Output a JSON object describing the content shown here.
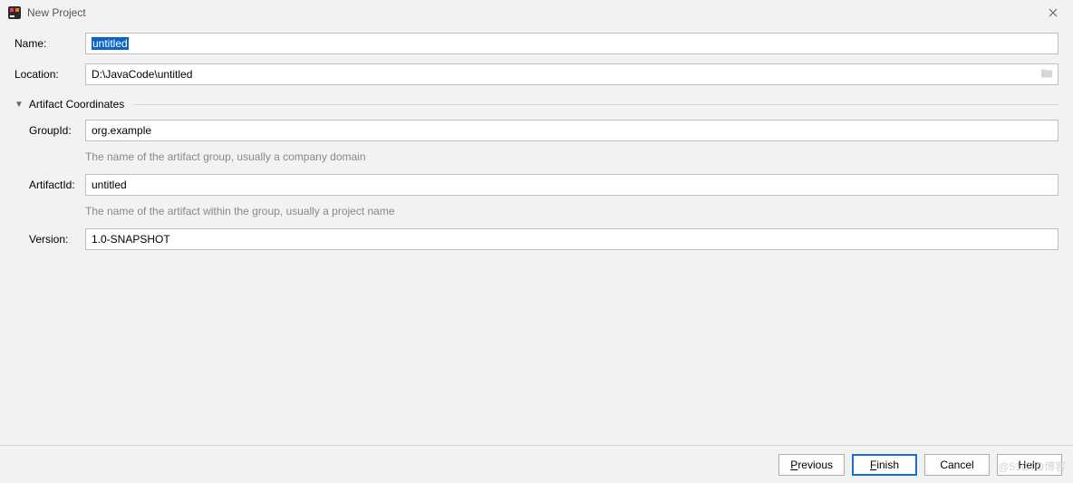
{
  "window": {
    "title": "New Project"
  },
  "fields": {
    "name_label": "Name:",
    "name_value": "untitled",
    "location_label": "Location:",
    "location_value": "D:\\JavaCode\\untitled"
  },
  "section": {
    "title": "Artifact Coordinates"
  },
  "artifact": {
    "group_label": "GroupId:",
    "group_value": "org.example",
    "group_hint": "The name of the artifact group, usually a company domain",
    "artifact_label": "ArtifactId:",
    "artifact_value": "untitled",
    "artifact_hint": "The name of the artifact within the group, usually a project name",
    "version_label": "Version:",
    "version_value": "1.0-SNAPSHOT"
  },
  "buttons": {
    "previous": "Previous",
    "finish": "Finish",
    "cancel": "Cancel",
    "help": "Help"
  },
  "watermark": "@51CTO博客"
}
